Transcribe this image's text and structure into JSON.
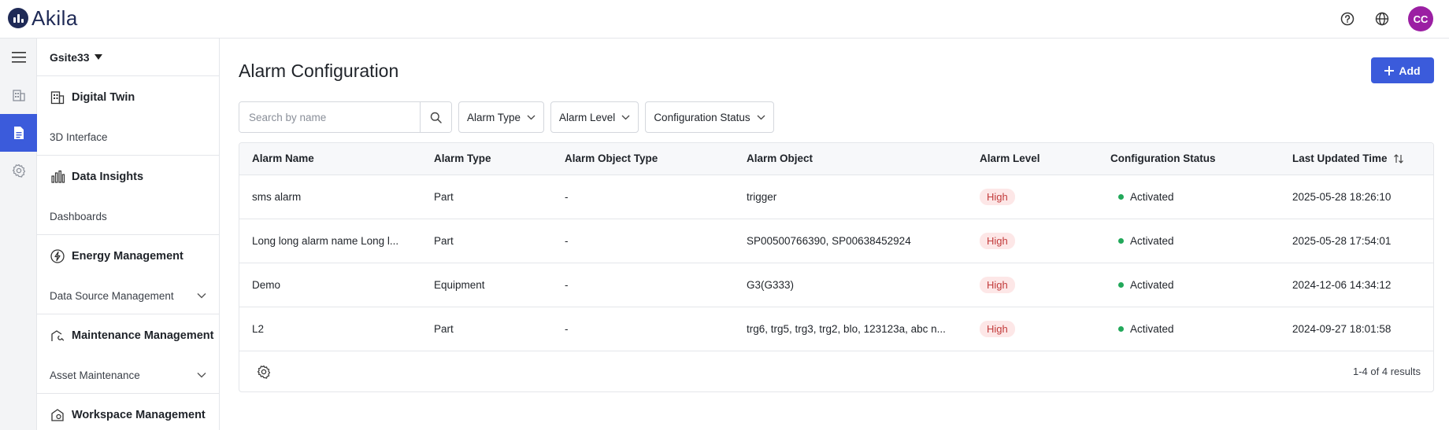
{
  "header": {
    "brand": "Akila",
    "user_initials": "CC",
    "help_icon": "help-circle-icon",
    "language_icon": "globe-icon"
  },
  "rail": {
    "items": [
      {
        "icon": "menu-icon"
      },
      {
        "icon": "building-icon"
      },
      {
        "icon": "document-icon",
        "active": true
      },
      {
        "icon": "gear-icon"
      }
    ]
  },
  "sidebar": {
    "site": "Gsite33",
    "groups": [
      {
        "title": "Digital Twin",
        "icon": "building-icon",
        "items": [
          {
            "label": "3D Interface",
            "expandable": false
          }
        ]
      },
      {
        "title": "Data Insights",
        "icon": "bar-chart-icon",
        "items": [
          {
            "label": "Dashboards",
            "expandable": false
          }
        ]
      },
      {
        "title": "Energy Management",
        "icon": "lightning-icon",
        "items": [
          {
            "label": "Data Source Management",
            "expandable": true
          }
        ]
      },
      {
        "title": "Maintenance Management",
        "icon": "wrench-icon",
        "items": [
          {
            "label": "Asset Maintenance",
            "expandable": true
          }
        ]
      },
      {
        "title": "Workspace Management",
        "icon": "workspace-icon",
        "items": []
      }
    ]
  },
  "main": {
    "title": "Alarm Configuration",
    "add_label": "Add",
    "search": {
      "placeholder": "Search by name",
      "value": ""
    },
    "filters": [
      "Alarm Type",
      "Alarm Level",
      "Configuration Status"
    ],
    "columns": [
      "Alarm Name",
      "Alarm Type",
      "Alarm Object Type",
      "Alarm Object",
      "Alarm Level",
      "Configuration Status",
      "Last Updated Time"
    ],
    "rows": [
      {
        "name": "sms alarm",
        "type": "Part",
        "object_type": "-",
        "object": "trigger",
        "level": "High",
        "status": "Activated",
        "updated": "2025-05-28 18:26:10"
      },
      {
        "name": "Long long alarm name Long l...",
        "type": "Part",
        "object_type": "-",
        "object": "SP00500766390, SP00638452924",
        "level": "High",
        "status": "Activated",
        "updated": "2025-05-28 17:54:01"
      },
      {
        "name": "Demo",
        "type": "Equipment",
        "object_type": "-",
        "object": "G3(G333)",
        "level": "High",
        "status": "Activated",
        "updated": "2024-12-06 14:34:12"
      },
      {
        "name": "L2",
        "type": "Part",
        "object_type": "-",
        "object": "trg6, trg5, trg3, trg2, blo, 123123a, abc n...",
        "level": "High",
        "status": "Activated",
        "updated": "2024-09-27 18:01:58"
      }
    ],
    "results_text": "1-4 of 4 results",
    "colors": {
      "accent": "#3b5bdb",
      "high_bg": "#fde7e7",
      "high_text": "#c23b3b",
      "active_dot": "#22a85a"
    }
  }
}
